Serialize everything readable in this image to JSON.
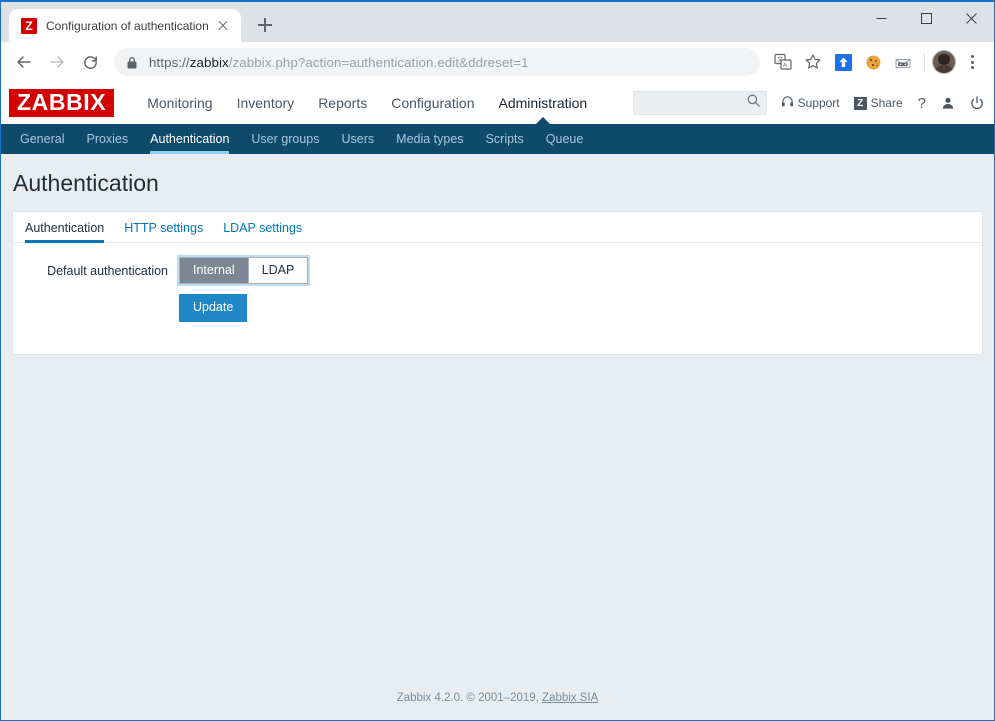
{
  "browser": {
    "tab": {
      "title": "Configuration of authentication",
      "favicon_letter": "Z",
      "favicon_name": "zabbix-favicon",
      "close_name": "close-icon"
    },
    "newtab_label": "+",
    "window_controls": {
      "minimize": "minimize-icon",
      "maximize": "maximize-icon",
      "close": "close-icon"
    },
    "nav": {
      "back": "back-arrow-icon",
      "forward": "forward-arrow-icon",
      "reload": "reload-icon"
    },
    "omnibox": {
      "lock": "lock-icon",
      "scheme": "https://",
      "host": "zabbix",
      "path": "/zabbix.php?action=authentication.edit&ddreset=1",
      "full_url": "https://zabbix/zabbix.php?action=authentication.edit&ddreset=1"
    },
    "toolbar_icons": [
      "translate-icon",
      "bookmark-star-icon",
      "extension-blue-arrow-icon",
      "extension-cookie-icon",
      "extension-mask-icon"
    ],
    "profile": "avatar",
    "menu": "kebab-menu-icon"
  },
  "zabbix": {
    "logo": "ZABBIX",
    "main_nav": [
      {
        "label": "Monitoring",
        "selected": false
      },
      {
        "label": "Inventory",
        "selected": false
      },
      {
        "label": "Reports",
        "selected": false
      },
      {
        "label": "Configuration",
        "selected": false
      },
      {
        "label": "Administration",
        "selected": true
      }
    ],
    "search": {
      "value": "",
      "placeholder": "",
      "icon": "search-icon"
    },
    "header_actions": {
      "support_label": "Support",
      "support_icon": "headset-icon",
      "share_label": "Share",
      "share_badge": "Z",
      "help_label": "?",
      "user_icon": "user-icon",
      "signout_icon": "power-icon"
    },
    "submenu": [
      {
        "label": "General",
        "selected": false
      },
      {
        "label": "Proxies",
        "selected": false
      },
      {
        "label": "Authentication",
        "selected": true
      },
      {
        "label": "User groups",
        "selected": false
      },
      {
        "label": "Users",
        "selected": false
      },
      {
        "label": "Media types",
        "selected": false
      },
      {
        "label": "Scripts",
        "selected": false
      },
      {
        "label": "Queue",
        "selected": false
      }
    ],
    "page_title": "Authentication",
    "form_tabs": [
      {
        "label": "Authentication",
        "active": true
      },
      {
        "label": "HTTP settings",
        "active": false
      },
      {
        "label": "LDAP settings",
        "active": false
      }
    ],
    "form": {
      "default_auth_label": "Default authentication",
      "options": [
        {
          "label": "Internal",
          "selected": true
        },
        {
          "label": "LDAP",
          "selected": false
        }
      ],
      "update_label": "Update"
    },
    "footer": {
      "text": "Zabbix 4.2.0. © 2001–2019, ",
      "link": "Zabbix SIA"
    },
    "colors": {
      "logo_red": "#d40000",
      "submenu_blue": "#0e4a6b",
      "accent_blue": "#0275b8",
      "button_blue": "#1f87c6",
      "selected_gray": "#7d8793",
      "content_bg": "#e8edf1"
    }
  }
}
